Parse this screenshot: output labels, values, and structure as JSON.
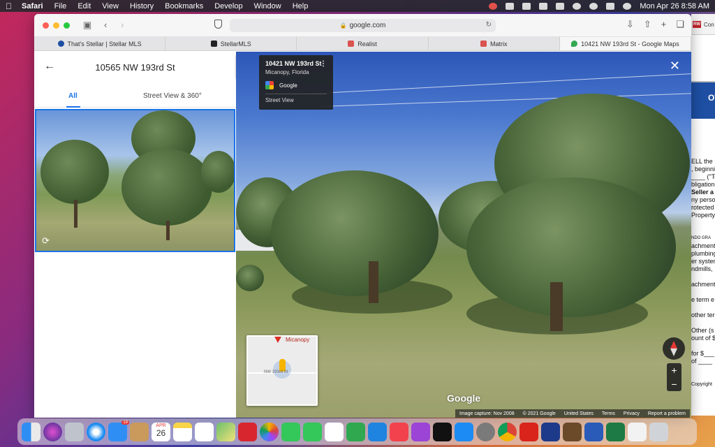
{
  "menubar": {
    "app": "Safari",
    "items": [
      "File",
      "Edit",
      "View",
      "History",
      "Bookmarks",
      "Develop",
      "Window",
      "Help"
    ],
    "clock": "Mon Apr 26  8:58 AM"
  },
  "browser": {
    "url": "google.com",
    "tabs": [
      {
        "label": "That's Stellar | Stellar MLS",
        "color": "#1e4fa3"
      },
      {
        "label": "StellarMLS",
        "color": "#222222"
      },
      {
        "label": "Realist",
        "color": "#d9534f"
      },
      {
        "label": "Matrix",
        "color": "#d9534f"
      },
      {
        "label": "10421 NW 193rd St - Google Maps",
        "color": "#34a853"
      }
    ]
  },
  "leftpanel": {
    "title": "10565 NW 193rd St",
    "tab_all": "All",
    "tab_sv": "Street View & 360°"
  },
  "infocard": {
    "address": "10421 NW 193rd St",
    "city": "Micanopy, Florida",
    "brand": "Google",
    "label": "Street View"
  },
  "minimap": {
    "place": "Micanopy",
    "road": "NW 193rd St"
  },
  "map": {
    "logo": "Google",
    "footer": [
      "Image capture: Nov 2008",
      "© 2021 Google",
      "United States",
      "Terms",
      "Privacy",
      "Report a problem"
    ]
  },
  "bgdoc": {
    "app_label": "Con",
    "banner": "OT",
    "lines": [
      "ELL the",
      ", beginni",
      "____ (\"Te",
      "bligation",
      "Seller a",
      "ny perso",
      "rotected",
      "Property",
      "",
      "",
      "NDO GRA",
      "achment",
      "plumbing",
      "er system",
      "ndmills,",
      "",
      "achment",
      "",
      "e term e",
      "",
      "other ter",
      "",
      "Other (s",
      "ount of $",
      "",
      "for $___",
      "of ____",
      "",
      "",
      "Copyright"
    ]
  },
  "dock": {
    "apps": [
      "finder",
      "siri",
      "launchpad",
      "safari",
      "mail",
      "contacts",
      "calendar",
      "notes",
      "reminders",
      "maps",
      "photo-booth",
      "photos",
      "messages",
      "facetime",
      "freeform",
      "numbers",
      "keynote",
      "news",
      "podcasts",
      "apple-tv",
      "app-store",
      "system-preferences",
      "chrome",
      "acrobat",
      "amazon-music",
      "cheetah",
      "word",
      "excel",
      "preview",
      "trash"
    ],
    "calendar_day": "26",
    "calendar_month": "APR",
    "mail_badge": "19"
  }
}
